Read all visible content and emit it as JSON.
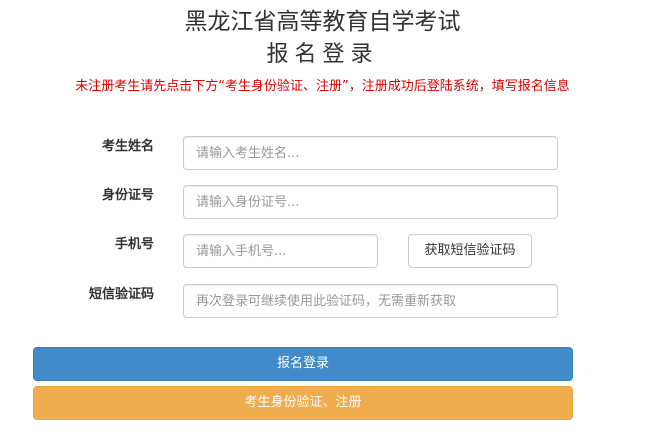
{
  "header": {
    "title": "黑龙江省高等教育自学考试",
    "subtitle": "报名登录",
    "notice": "未注册考生请先点击下方“考生身份验证、注册”，注册成功后登陆系统，填写报名信息"
  },
  "form": {
    "name": {
      "label": "考生姓名",
      "placeholder": "请输入考生姓名..."
    },
    "id_number": {
      "label": "身份证号",
      "placeholder": "请输入身份证号..."
    },
    "phone": {
      "label": "手机号",
      "placeholder": "请输入手机号..."
    },
    "sms_button_label": "获取短信验证码",
    "sms_code": {
      "label": "短信验证码",
      "placeholder": "再次登录可继续使用此验证码，无需重新获取"
    }
  },
  "actions": {
    "login_label": "报名登录",
    "register_label": "考生身份验证、注册"
  },
  "colors": {
    "notice": "#e00000",
    "login_button": "#428bca",
    "register_button": "#f0ad4e"
  }
}
